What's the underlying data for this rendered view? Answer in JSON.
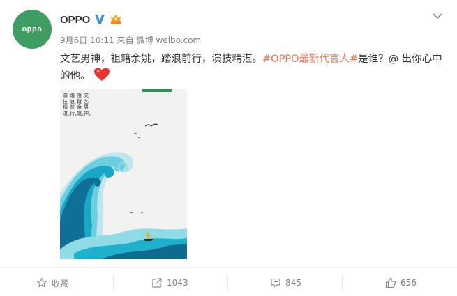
{
  "user": {
    "name": "OPPO",
    "avatar_text": "oppo"
  },
  "meta": {
    "date": "9月6日 10:11",
    "source_prefix": "来自",
    "source": "微博 weibo.com"
  },
  "post": {
    "text_before": "文艺男神，祖籍余姚，踏浪前行，演技精湛。",
    "topic": "#OPPO最新代言人#",
    "text_after": "是谁？@ 出你心中的他。"
  },
  "poster": {
    "col1": "文艺男神，",
    "col2": "祖籍余姚，",
    "col3": "踏浪前行，",
    "col4": "演技精湛。"
  },
  "actions": {
    "favorite": "收藏",
    "share_count": "1043",
    "comment_count": "845",
    "like_count": "656"
  },
  "colors": {
    "avatar_bg": "#3f9d63",
    "topic": "#eb7350",
    "verified": "#3a8de0",
    "meta": "#808080"
  }
}
